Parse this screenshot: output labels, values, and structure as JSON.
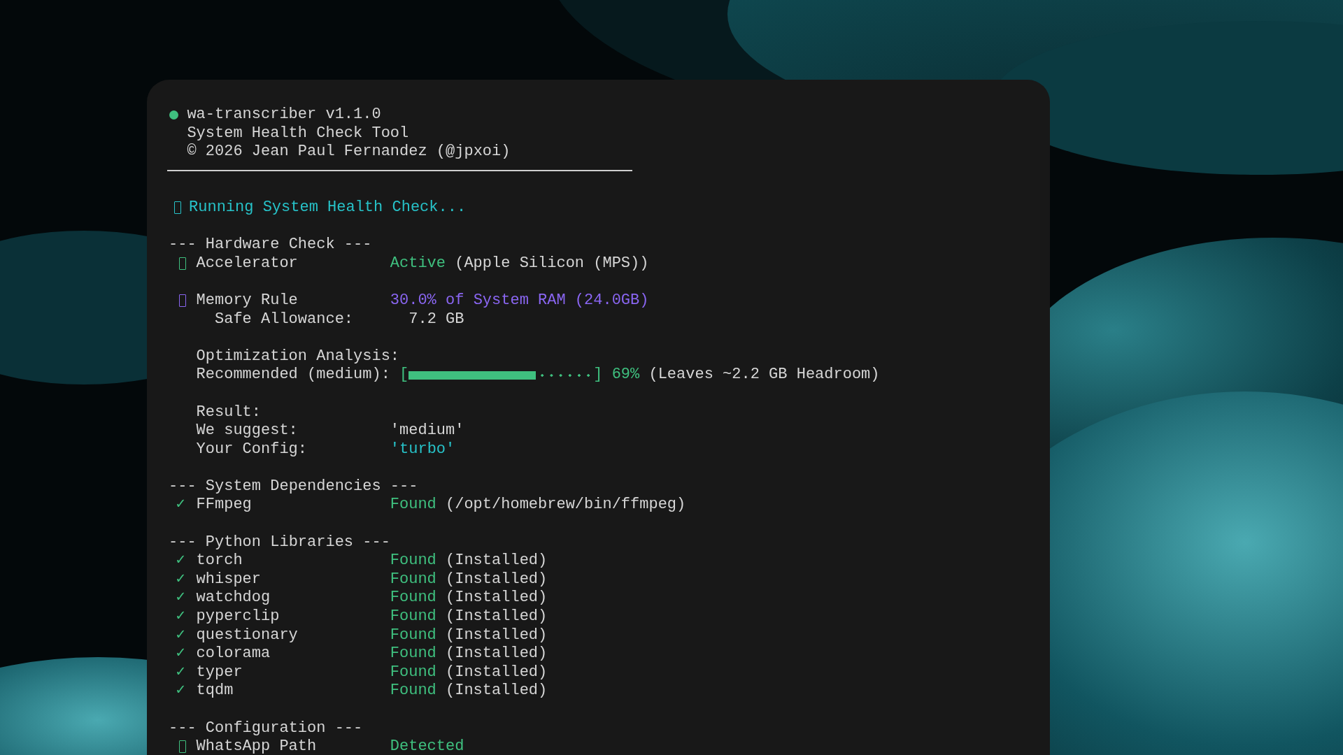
{
  "header": {
    "title": "wa-transcriber v1.1.0",
    "subtitle": "System Health Check Tool",
    "copyright": "© 2026 Jean Paul Fernandez (@jpxoi)"
  },
  "blocks": [
    [
      {
        "kind": "status",
        "marker": {
          "kind": "glyph",
          "color": "#27c2c8"
        },
        "text": "Running System Health Check..."
      }
    ],
    [
      {
        "kind": "section",
        "text": "--- Hardware Check ---"
      },
      {
        "kind": "check",
        "marker": {
          "kind": "glyph",
          "color": "#3fc07f"
        },
        "label": "Accelerator",
        "value": "Active",
        "color": "#3fc07f",
        "note": "(Apple Silicon (MPS))"
      }
    ],
    [
      {
        "kind": "check",
        "marker": {
          "kind": "glyph",
          "color": "#8a66f2"
        },
        "label": "Memory Rule",
        "value": "30.0% of System RAM (24.0GB)",
        "color": "#8a66f2"
      },
      {
        "kind": "detail",
        "label": "Safe Allowance:",
        "value": "7.2 GB"
      }
    ],
    [
      {
        "kind": "text",
        "text": "Optimization Analysis:"
      },
      {
        "kind": "progress",
        "label": "Recommended (medium):",
        "open": "[",
        "close": "]",
        "level": 0.69,
        "percent": "69%",
        "note": "(Leaves ~2.2 GB Headroom)"
      }
    ],
    [
      {
        "kind": "text",
        "text": "Result:"
      },
      {
        "kind": "kv",
        "label": "We suggest:",
        "value": "'medium'"
      },
      {
        "kind": "kv",
        "label": "Your Config:",
        "value": "'turbo'",
        "color": "#27c2c8"
      }
    ],
    [
      {
        "kind": "section",
        "text": "--- System Dependencies ---"
      },
      {
        "kind": "check",
        "marker": {
          "kind": "tick",
          "symbol": "✓"
        },
        "label": "FFmpeg",
        "value": "Found",
        "color": "#3fc07f",
        "note": "(/opt/homebrew/bin/ffmpeg)"
      }
    ],
    [
      {
        "kind": "section",
        "text": "--- Python Libraries ---"
      },
      {
        "kind": "check",
        "marker": {
          "kind": "tick",
          "symbol": "✓"
        },
        "label": "torch",
        "value": "Found",
        "color": "#3fc07f",
        "note": "(Installed)"
      },
      {
        "kind": "check",
        "marker": {
          "kind": "tick",
          "symbol": "✓"
        },
        "label": "whisper",
        "value": "Found",
        "color": "#3fc07f",
        "note": "(Installed)"
      },
      {
        "kind": "check",
        "marker": {
          "kind": "tick",
          "symbol": "✓"
        },
        "label": "watchdog",
        "value": "Found",
        "color": "#3fc07f",
        "note": "(Installed)"
      },
      {
        "kind": "check",
        "marker": {
          "kind": "tick",
          "symbol": "✓"
        },
        "label": "pyperclip",
        "value": "Found",
        "color": "#3fc07f",
        "note": "(Installed)"
      },
      {
        "kind": "check",
        "marker": {
          "kind": "tick",
          "symbol": "✓"
        },
        "label": "questionary",
        "value": "Found",
        "color": "#3fc07f",
        "note": "(Installed)"
      },
      {
        "kind": "check",
        "marker": {
          "kind": "tick",
          "symbol": "✓"
        },
        "label": "colorama",
        "value": "Found",
        "color": "#3fc07f",
        "note": "(Installed)"
      },
      {
        "kind": "check",
        "marker": {
          "kind": "tick",
          "symbol": "✓"
        },
        "label": "typer",
        "value": "Found",
        "color": "#3fc07f",
        "note": "(Installed)"
      },
      {
        "kind": "check",
        "marker": {
          "kind": "tick",
          "symbol": "✓"
        },
        "label": "tqdm",
        "value": "Found",
        "color": "#3fc07f",
        "note": "(Installed)"
      }
    ],
    [
      {
        "kind": "section",
        "text": "--- Configuration ---"
      },
      {
        "kind": "check",
        "marker": {
          "kind": "glyph",
          "color": "#3fc07f"
        },
        "label": "WhatsApp Path",
        "value": "Detected",
        "color": "#3fc07f"
      }
    ]
  ]
}
